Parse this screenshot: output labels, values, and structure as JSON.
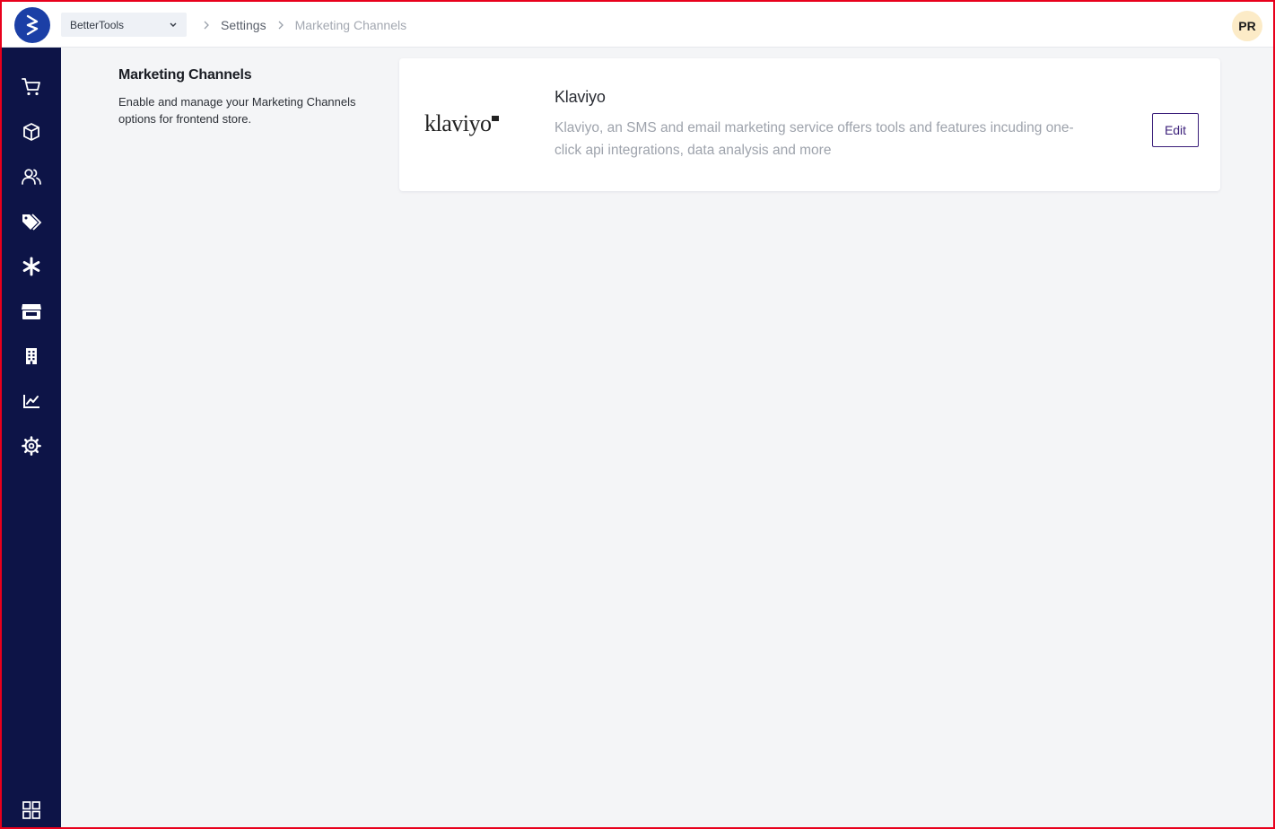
{
  "header": {
    "store_selector": {
      "value": "BetterTools"
    },
    "breadcrumbs": [
      {
        "label": "Settings"
      },
      {
        "label": "Marketing Channels"
      }
    ],
    "avatar_initials": "PR"
  },
  "sidebar": {
    "items": [
      {
        "name": "orders",
        "icon": "cart-icon"
      },
      {
        "name": "products",
        "icon": "box-icon"
      },
      {
        "name": "customers",
        "icon": "users-icon"
      },
      {
        "name": "discounts",
        "icon": "tags-icon"
      },
      {
        "name": "attributes",
        "icon": "asterisk-icon"
      },
      {
        "name": "stores",
        "icon": "store-icon"
      },
      {
        "name": "organization",
        "icon": "building-icon"
      },
      {
        "name": "analytics",
        "icon": "chart-line-icon"
      },
      {
        "name": "settings",
        "icon": "gear-icon"
      }
    ],
    "bottom_item": {
      "name": "apps",
      "icon": "grid-icon"
    }
  },
  "section": {
    "title": "Marketing Channels",
    "description": "Enable and manage your Marketing Channels options for frontend store."
  },
  "channels": [
    {
      "logo_text": "klaviyo",
      "title": "Klaviyo",
      "description": "Klaviyo, an SMS and email marketing service offers tools and features incuding one-click api integrations, data analysis and more",
      "action_label": "Edit"
    }
  ],
  "colors": {
    "sidebar_bg": "#0d1447",
    "logo_bg": "#1b3fa6",
    "accent": "#3b1f7a",
    "avatar_bg": "#fcebc7",
    "page_bg": "#f4f5f7"
  }
}
